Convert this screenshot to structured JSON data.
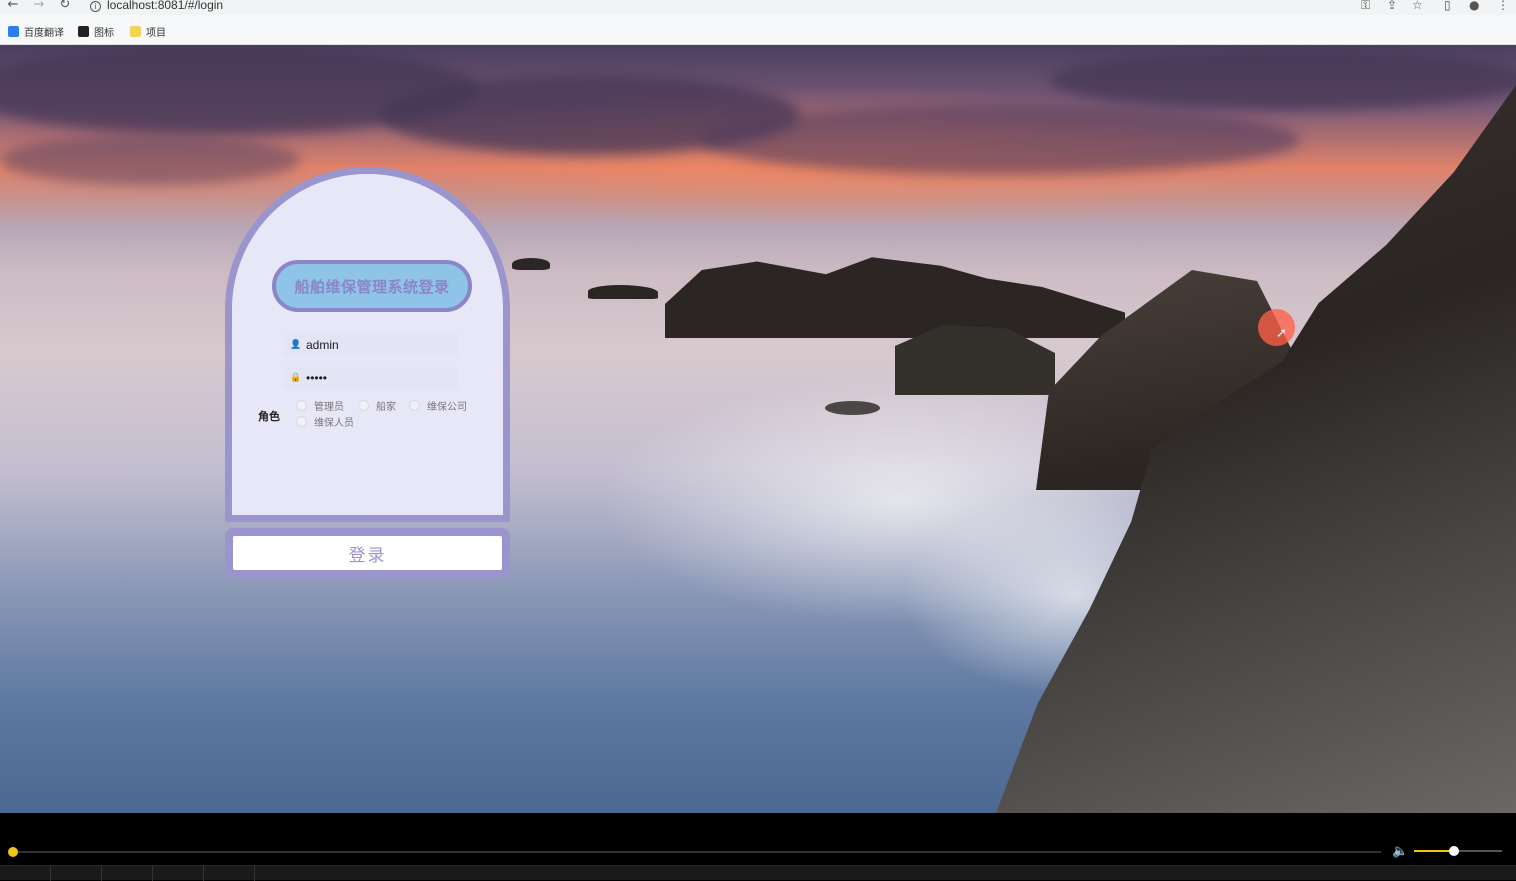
{
  "browser": {
    "url": "localhost:8081/#/login",
    "bookmarks": [
      {
        "label": "百度翻译",
        "icon": "translate-icon",
        "color": "#2a7ef0"
      },
      {
        "label": "图标",
        "icon": "image-icon",
        "color": "#222222"
      },
      {
        "label": "项目",
        "icon": "folder-icon",
        "color": "#f5d35a"
      }
    ]
  },
  "login": {
    "title": "船舶维保管理系统登录",
    "username_value": "admin",
    "password_value": "•••••",
    "role_label": "角色",
    "roles": [
      "管理员",
      "船家",
      "维保公司",
      "维保人员"
    ],
    "submit_label": "登录"
  },
  "player": {
    "progress": 0.0,
    "volume": 0.45
  },
  "colors": {
    "card_bg": "#e8e7f7",
    "card_border": "#9a96cd",
    "title_pill_bg": "#8fc3e8",
    "accent": "#f0c419"
  }
}
